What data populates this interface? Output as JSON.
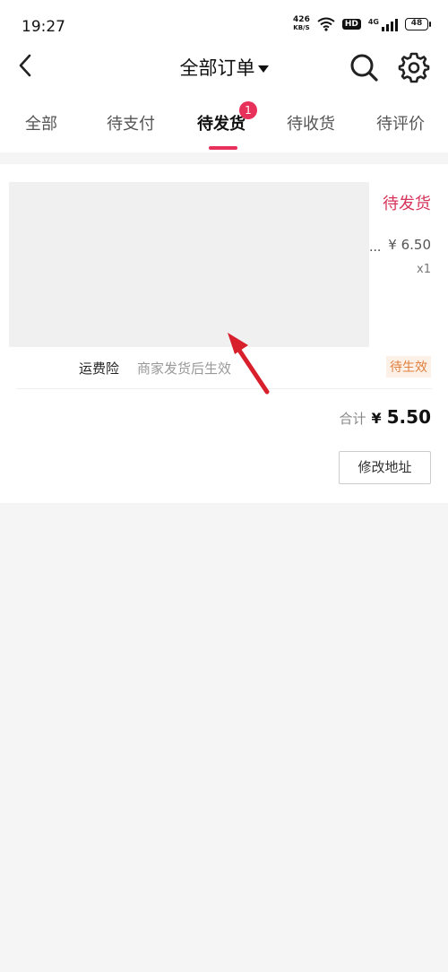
{
  "status_bar": {
    "time": "19:27",
    "net_speed": "426",
    "net_unit": "KB/S",
    "hd": "HD",
    "signal_type": "4G",
    "battery": "48"
  },
  "header": {
    "title": "全部订单"
  },
  "tabs": [
    {
      "label": "全部"
    },
    {
      "label": "待支付"
    },
    {
      "label": "待发货",
      "badge": "1"
    },
    {
      "label": "待收货"
    },
    {
      "label": "待评价"
    }
  ],
  "order": {
    "status": "待发货",
    "title_truncated": "...",
    "price": "¥ 6.50",
    "quantity": "x1",
    "insurance_label": "运费险",
    "insurance_desc": "商家发货后生效",
    "insurance_status": "待生效",
    "total_label": "合计",
    "total_currency": "¥",
    "total_value": "5.50",
    "address_button": "修改地址"
  },
  "colors": {
    "accent": "#e7305a",
    "status_text": "#d6345a",
    "insurance_status": "#e08040",
    "annotation_arrow": "#d8202c"
  }
}
